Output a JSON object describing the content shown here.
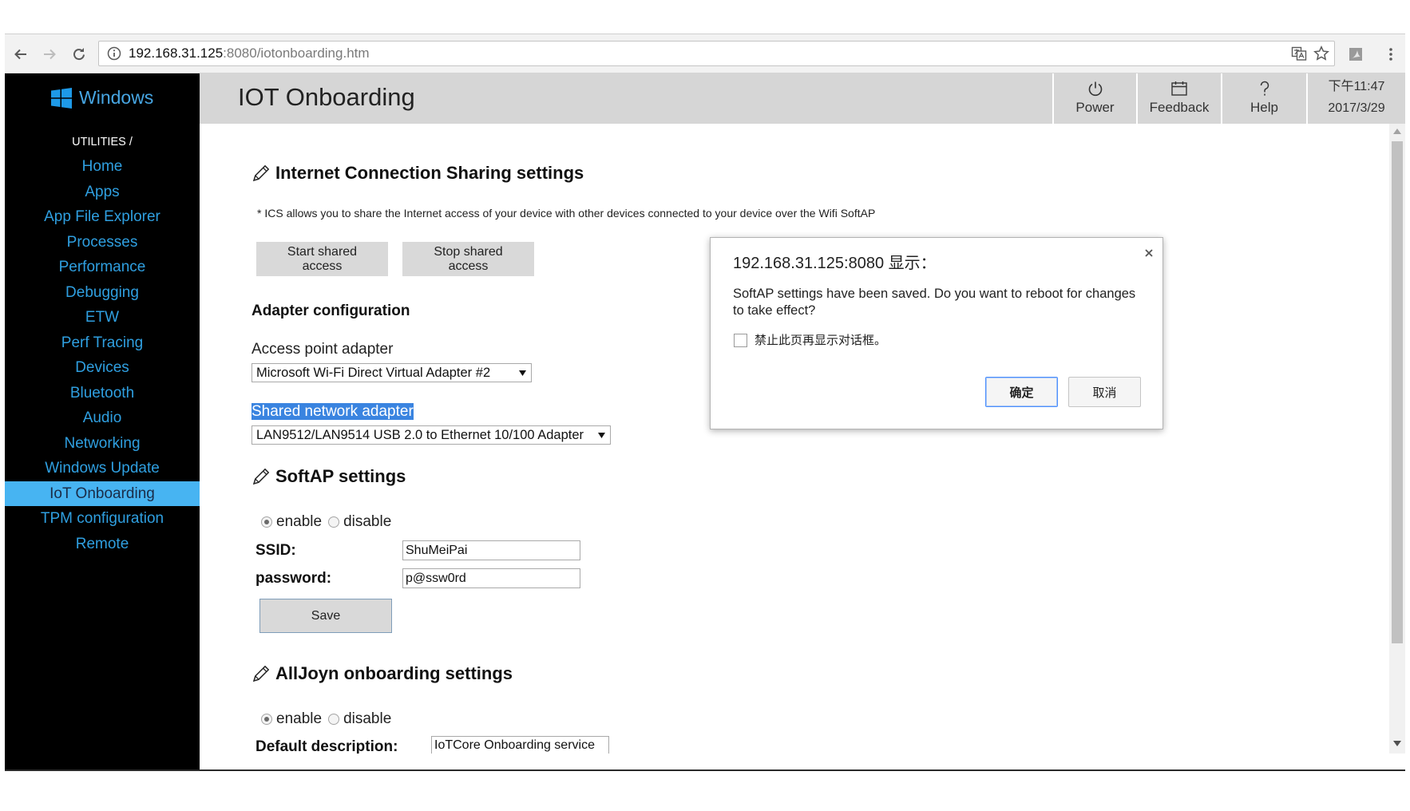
{
  "browser": {
    "url_host": "192.168.31.125",
    "url_path": ":8080/iotonboarding.htm"
  },
  "sidebar": {
    "brand": "Windows",
    "section": "UTILITIES /",
    "items": [
      {
        "label": "Home"
      },
      {
        "label": "Apps"
      },
      {
        "label": "App File Explorer"
      },
      {
        "label": "Processes"
      },
      {
        "label": "Performance"
      },
      {
        "label": "Debugging"
      },
      {
        "label": "ETW"
      },
      {
        "label": "Perf Tracing"
      },
      {
        "label": "Devices"
      },
      {
        "label": "Bluetooth"
      },
      {
        "label": "Audio"
      },
      {
        "label": "Networking"
      },
      {
        "label": "Windows Update"
      },
      {
        "label": "IoT Onboarding",
        "active": true
      },
      {
        "label": "TPM configuration"
      },
      {
        "label": "Remote"
      }
    ]
  },
  "header": {
    "title": "IOT Onboarding",
    "power_label": "Power",
    "feedback_label": "Feedback",
    "help_label": "Help",
    "time": "下午11:47",
    "date": "2017/3/29"
  },
  "ics": {
    "heading": "Internet Connection Sharing settings",
    "note": "* ICS allows you to share the Internet access of your device with other devices connected to your device over the Wifi SoftAP",
    "start_label": "Start shared access",
    "stop_label": "Stop shared access"
  },
  "adapter": {
    "heading": "Adapter configuration",
    "access_point_label": "Access point adapter",
    "access_point_value": "Microsoft Wi-Fi Direct Virtual Adapter #2",
    "shared_label": "Shared network adapter",
    "shared_value": "LAN9512/LAN9514 USB 2.0 to Ethernet 10/100 Adapter"
  },
  "softap": {
    "heading": "SoftAP settings",
    "enable_label": "enable",
    "disable_label": "disable",
    "enabled": true,
    "ssid_label": "SSID:",
    "ssid": "ShuMeiPai",
    "password_label": "password:",
    "password": "p@ssw0rd",
    "save_label": "Save"
  },
  "alljoyn": {
    "heading": "AllJoyn onboarding settings",
    "enable_label": "enable",
    "disable_label": "disable",
    "enabled": true,
    "description_label": "Default description:",
    "description": "IoTCore Onboarding service"
  },
  "dialog": {
    "title": "192.168.31.125:8080 显示：",
    "message": "SoftAP settings have been saved. Do you want to reboot for changes to take effect?",
    "checkbox_label": "禁止此页再显示对话框。",
    "ok_label": "确定",
    "cancel_label": "取消"
  },
  "colors": {
    "sidebar_link": "#2f9fe0",
    "brand": "#47a6e3",
    "active_bg": "#47b4f2",
    "header_bg": "#d6d6d6",
    "selection": "#3a84e0",
    "logo": "#1e9ae8"
  }
}
